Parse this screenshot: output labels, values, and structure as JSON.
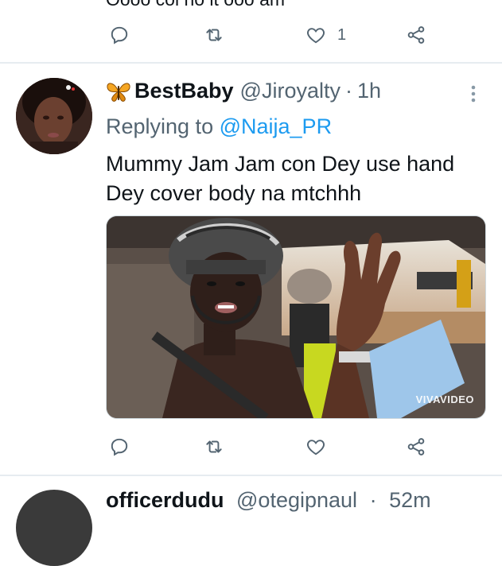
{
  "previous_tweet": {
    "cut_text": "Oooo coi no it ooo am",
    "like_count": "1"
  },
  "tweet": {
    "display_name": "BestBaby",
    "handle": "@Jiroyalty",
    "separator": "·",
    "time": "1h",
    "replying_prefix": "Replying to",
    "replying_to": "@Naija_PR",
    "text": "Mummy Jam Jam con Dey use hand Dey cover body na mtchhh",
    "media_watermark": "VIVAVIDEO",
    "like_count": ""
  },
  "next_tweet": {
    "display_name": "officerdudu",
    "handle": "@otegipnaul",
    "separator": "·",
    "time": "52m"
  },
  "colors": {
    "text_primary": "#0f1419",
    "text_secondary": "#536471",
    "link": "#1d9bf0",
    "divider": "#e6ecf0"
  },
  "icons": {
    "reply": "reply-icon",
    "retweet": "retweet-icon",
    "like": "heart-icon",
    "share": "share-icon",
    "more": "more-vertical-icon",
    "emoji": "butterfly-emoji"
  }
}
